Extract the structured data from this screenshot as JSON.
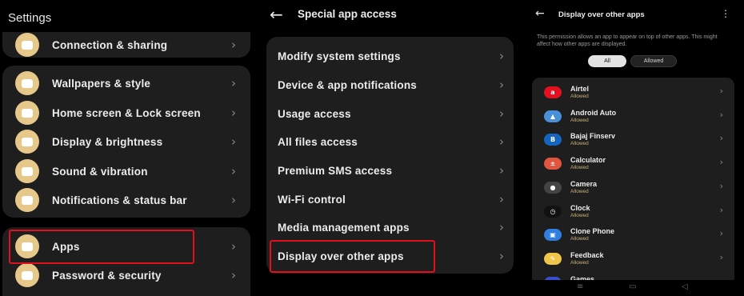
{
  "settings": {
    "title": "Settings",
    "top_item": {
      "label": "Connection & sharing",
      "icon": "share-icon"
    },
    "group1": [
      {
        "label": "Wallpapers & style",
        "icon": "palette-icon"
      },
      {
        "label": "Home screen & Lock screen",
        "icon": "image-icon"
      },
      {
        "label": "Display & brightness",
        "icon": "sun-icon"
      },
      {
        "label": "Sound & vibration",
        "icon": "bell-icon"
      },
      {
        "label": "Notifications & status bar",
        "icon": "notification-icon"
      }
    ],
    "group2": [
      {
        "label": "Apps",
        "icon": "apps-grid-icon"
      },
      {
        "label": "Password & security",
        "icon": "key-icon"
      }
    ]
  },
  "special_access": {
    "title": "Special app access",
    "items": [
      "Modify system settings",
      "Device & app notifications",
      "Usage access",
      "All files access",
      "Premium SMS access",
      "Wi-Fi control",
      "Media management apps",
      "Display over other apps"
    ]
  },
  "display_over": {
    "title": "Display over other apps",
    "description": "This permission allows an app to appear on top of other apps. This might affect how other apps are displayed.",
    "filters": {
      "all": "All",
      "allowed": "Allowed"
    },
    "apps": [
      {
        "name": "Airtel",
        "status": "Allowed",
        "color": "#e3101f",
        "glyph": "a"
      },
      {
        "name": "Android Auto",
        "status": "Allowed",
        "color": "#4a90d9",
        "glyph": "▲"
      },
      {
        "name": "Bajaj Finserv",
        "status": "Allowed",
        "color": "#1565c0",
        "glyph": "B"
      },
      {
        "name": "Calculator",
        "status": "Allowed",
        "color": "#e0553d",
        "glyph": "±"
      },
      {
        "name": "Camera",
        "status": "Allowed",
        "color": "#444444",
        "glyph": "●"
      },
      {
        "name": "Clock",
        "status": "Allowed",
        "color": "#111111",
        "glyph": "◷"
      },
      {
        "name": "Clone Phone",
        "status": "Allowed",
        "color": "#2f7fe0",
        "glyph": "▣"
      },
      {
        "name": "Feedback",
        "status": "Allowed",
        "color": "#f0c64a",
        "glyph": "✎"
      },
      {
        "name": "Games",
        "status": "",
        "color": "#3a4fd0",
        "glyph": ""
      }
    ]
  },
  "chevron": "›"
}
